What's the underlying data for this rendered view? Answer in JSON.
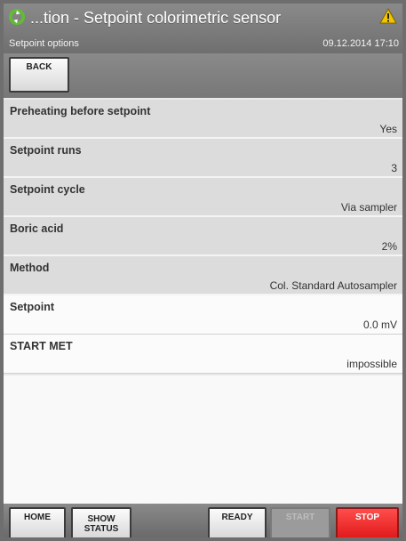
{
  "header": {
    "title": "...tion - Setpoint colorimetric sensor",
    "subtitle": "Setpoint options",
    "datetime": "09.12.2014 17:10"
  },
  "toolbar": {
    "back_label": "BACK"
  },
  "rows": [
    {
      "label": "Preheating before setpoint",
      "value": "Yes"
    },
    {
      "label": "Setpoint runs",
      "value": "3"
    },
    {
      "label": "Setpoint cycle",
      "value": "Via sampler"
    },
    {
      "label": "Boric acid",
      "value": "2%"
    },
    {
      "label": "Method",
      "value": "Col. Standard Autosampler"
    },
    {
      "label": "Setpoint",
      "value": "0.0 mV"
    },
    {
      "label": "START MET",
      "value": "impossible"
    }
  ],
  "footer": {
    "home": "HOME",
    "show_status_line1": "SHOW",
    "show_status_line2": "STATUS",
    "ready": "READY",
    "start": "START",
    "stop": "STOP"
  },
  "colors": {
    "accent_green": "#5fbf2f",
    "warning_yellow": "#f2c400",
    "stop_red": "#e21b1b"
  },
  "icons": {
    "app": "recycle-arrows-icon",
    "warning": "warning-triangle-icon"
  }
}
